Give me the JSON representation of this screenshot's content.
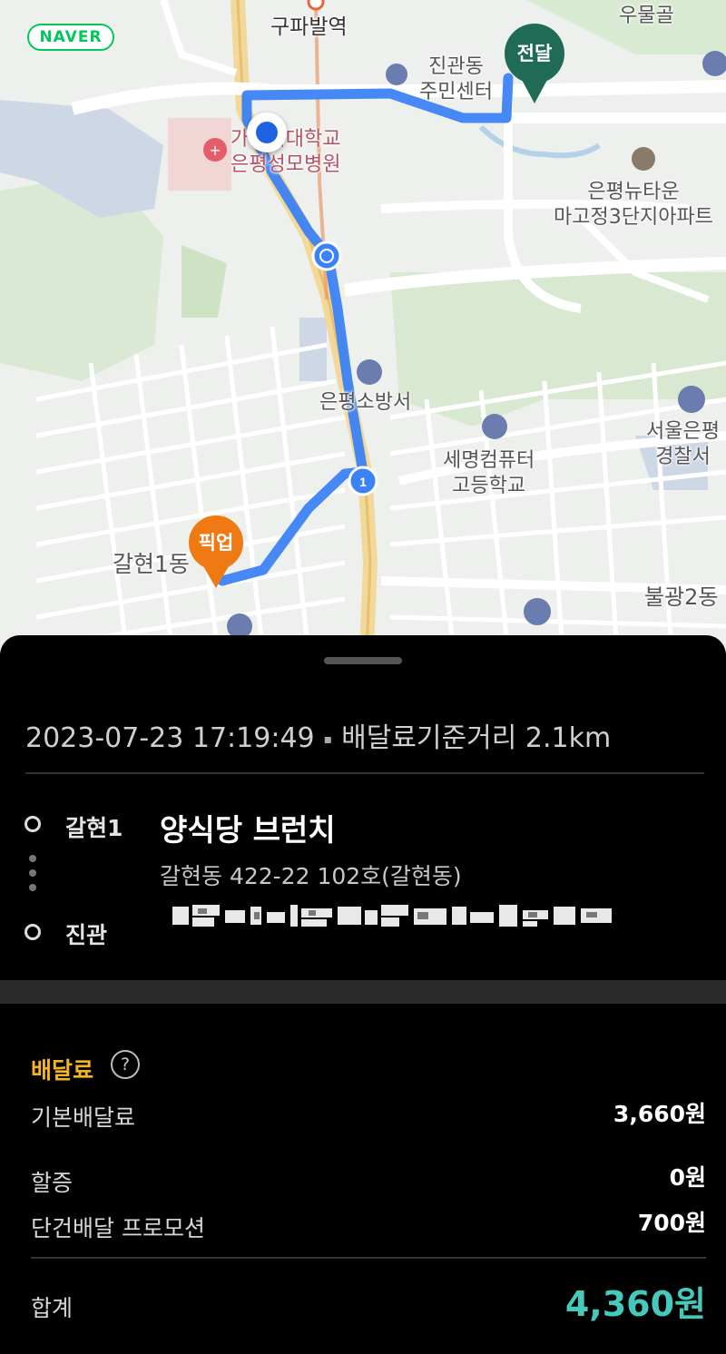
{
  "map": {
    "provider_logo": "NAVER",
    "labels": {
      "station": "구파발역",
      "umulgol": "우물골",
      "community_center": "진관동\n주민센터",
      "hospital": "가톨릭대학교\n은평성모병원",
      "apartment": "은평뉴타운\n마고정3단지아파트",
      "fire_station": "은평소방서",
      "school": "세명컴퓨터\n고등학교",
      "police": "서울은평\n경찰서",
      "galhyeon": "갈현1동",
      "bulgwang": "불광2동"
    },
    "pins": {
      "delivery": "전달",
      "pickup": "픽업"
    },
    "route_color": "#3b82f6"
  },
  "order": {
    "datetime": "2023-07-23 17:19:49",
    "separator": "▪",
    "distance_text": "배달료기준거리 2.1km",
    "pickup_area": "갈현1",
    "store_name": "양식당 브런치",
    "store_address": "갈현동 422-22 102호(갈현동)",
    "dropoff_area": "진관"
  },
  "fees": {
    "title": "배달료",
    "help_icon": "?",
    "rows": [
      {
        "label": "기본배달료",
        "value": "3,660원"
      },
      {
        "label": "할증",
        "value": "0원"
      },
      {
        "label": "단건배달 프로모션",
        "value": "700원"
      }
    ],
    "total_label": "합계",
    "total_value": "4,360원"
  },
  "colors": {
    "accent_yellow": "#f5b51c",
    "total_teal": "#45c9bd",
    "pickup_orange": "#ef7a14",
    "delivery_green": "#1f6b56"
  }
}
